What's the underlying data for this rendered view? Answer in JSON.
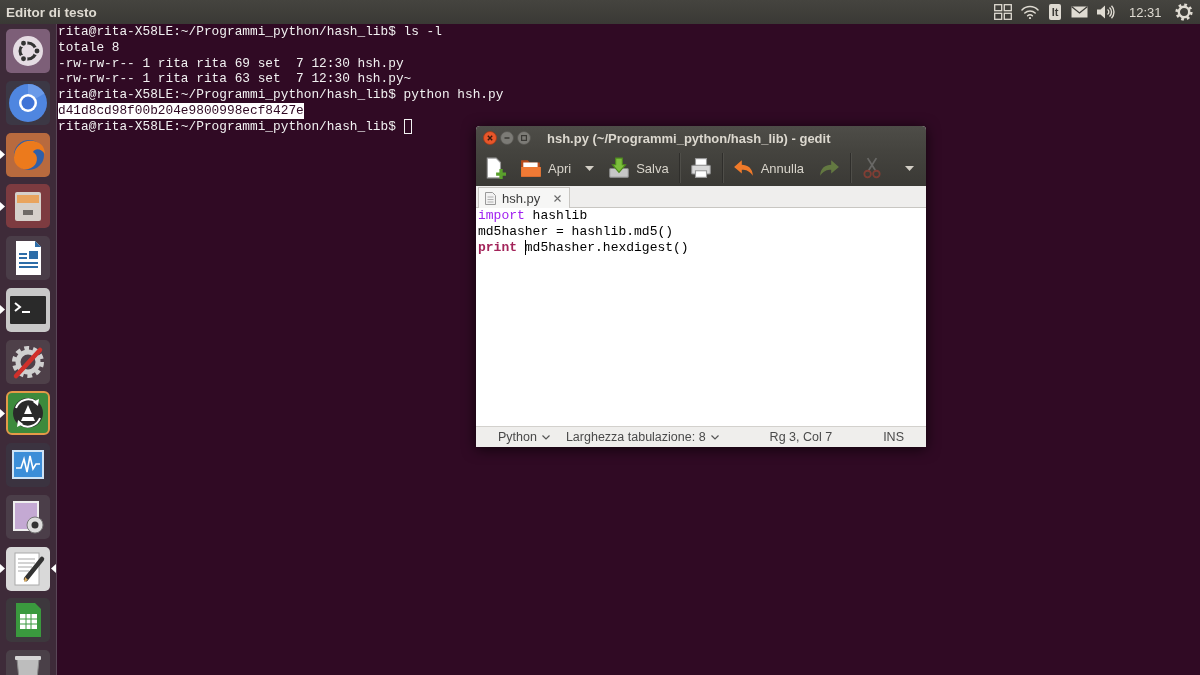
{
  "top_panel": {
    "app_title": "Editor di testo",
    "keyboard_layout": "It",
    "clock": "12:31"
  },
  "launcher": {
    "items": [
      {
        "kind": "dash",
        "running": false,
        "focused": false
      },
      {
        "kind": "ring",
        "running": false,
        "focused": false
      },
      {
        "kind": "globe",
        "running": true,
        "focused": false
      },
      {
        "kind": "cabinet",
        "running": true,
        "focused": false
      },
      {
        "kind": "document",
        "running": false,
        "focused": false
      },
      {
        "kind": "terminal",
        "running": true,
        "focused": false
      },
      {
        "kind": "tools",
        "running": false,
        "focused": false
      },
      {
        "kind": "updater",
        "running": true,
        "focused": false
      },
      {
        "kind": "monitor",
        "running": false,
        "focused": false
      },
      {
        "kind": "webcam",
        "running": false,
        "focused": false
      },
      {
        "kind": "editor",
        "running": true,
        "focused": true
      },
      {
        "kind": "spreadsheet",
        "running": false,
        "focused": false
      },
      {
        "kind": "trash",
        "running": false,
        "focused": false
      }
    ]
  },
  "terminal": {
    "lines": [
      {
        "text": "rita@rita-X58LE:~/Programmi_python/hash_lib$ ls -l",
        "selected": false,
        "cursor": false
      },
      {
        "text": "totale 8",
        "selected": false,
        "cursor": false
      },
      {
        "text": "-rw-rw-r-- 1 rita rita 69 set  7 12:30 hsh.py",
        "selected": false,
        "cursor": false
      },
      {
        "text": "-rw-rw-r-- 1 rita rita 63 set  7 12:30 hsh.py~",
        "selected": false,
        "cursor": false
      },
      {
        "text": "rita@rita-X58LE:~/Programmi_python/hash_lib$ python hsh.py",
        "selected": false,
        "cursor": false
      },
      {
        "text": "d41d8cd98f00b204e9800998ecf8427e",
        "selected": true,
        "cursor": false
      },
      {
        "text": "rita@rita-X58LE:~/Programmi_python/hash_lib$",
        "selected": false,
        "cursor": true
      }
    ]
  },
  "gedit": {
    "title": "hsh.py (~/Programmi_python/hash_lib) - gedit",
    "toolbar": {
      "groups": [
        {
          "items": [
            {
              "kind": "new",
              "disabled": false
            },
            {
              "kind": "open",
              "label": "Apri",
              "disabled": false
            },
            {
              "kind": "menu",
              "disabled": false
            },
            {
              "kind": "save",
              "label": "Salva",
              "disabled": false
            }
          ]
        },
        {
          "items": [
            {
              "kind": "print",
              "disabled": false
            }
          ]
        },
        {
          "items": [
            {
              "kind": "undo",
              "label": "Annulla",
              "disabled": false
            },
            {
              "kind": "redo",
              "disabled": true
            }
          ]
        },
        {
          "items": [
            {
              "kind": "cut",
              "disabled": true
            }
          ]
        }
      ],
      "overflow_menu": true
    },
    "tabs": [
      {
        "label": "hsh.py",
        "selected": true
      }
    ],
    "lines": [
      {
        "tokens": [
          {
            "kind": "preprocessor",
            "text": "import ",
            "caret": false
          },
          {
            "kind": "plain",
            "text": "hashlib",
            "caret": false
          }
        ]
      },
      {
        "tokens": [
          {
            "kind": "plain",
            "text": "md5hasher = hashlib.md5()",
            "caret": false
          }
        ]
      },
      {
        "tokens": [
          {
            "kind": "keyword",
            "text": "print ",
            "caret": false
          },
          {
            "kind": "plain",
            "text": "md5hasher.hexdigest()",
            "caret": true
          }
        ]
      }
    ],
    "status_bar": [
      {
        "kind": "dropdown",
        "label": "Python"
      },
      {
        "kind": "dropdown",
        "label": "Larghezza tabulazione: 8"
      },
      {
        "kind": "text",
        "label": "Rg 3, Col 7"
      },
      {
        "kind": "text",
        "label": "INS"
      }
    ]
  }
}
